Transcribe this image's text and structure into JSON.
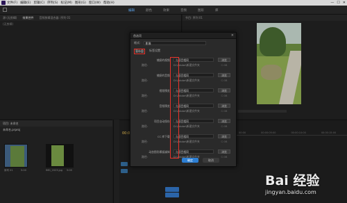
{
  "menubar": {
    "items": [
      "文件(F)",
      "编辑(E)",
      "剪辑(C)",
      "序列(S)",
      "标记(M)",
      "图形(G)",
      "窗口(W)",
      "帮助(H)"
    ],
    "window_buttons": [
      "—",
      "☐",
      "✕"
    ]
  },
  "workspaces": {
    "items": [
      "编辑",
      "颜色",
      "效果",
      "音频",
      "图形",
      "库"
    ],
    "active_index": 0
  },
  "source_panel": {
    "tabs": [
      "源:(无剪辑)",
      "效果控件",
      "音频剪辑混合器: 序列 01"
    ],
    "sub": "(无剪辑)"
  },
  "program_panel": {
    "tab": "节目: 序列 01"
  },
  "project_panel": {
    "tab": "项目: 未命名",
    "title": "未命名.prproj",
    "items": [
      {
        "name": "序列 01",
        "duration": "5:00"
      },
      {
        "name": "IMG_2023.jpg",
        "duration": "5:00"
      }
    ]
  },
  "timeline": {
    "timecode": "00:00:00:00",
    "ruler": [
      "00:00",
      "00:00:05:00",
      "00:00:10:00",
      "00:00:15:00"
    ]
  },
  "dialog": {
    "title": "首选项",
    "format_label": "格式:",
    "format_value": "影像",
    "tabs": [
      "暂存盘",
      "标签设置"
    ],
    "active_tab": 0,
    "settings": [
      {
        "name": "捕捉的视频:",
        "value": "与项目相同",
        "button": "浏览",
        "path_label": "路径:",
        "path": "D:\\Adobe\\新建文件夹",
        "extra": "C:0B"
      },
      {
        "name": "捕捉的音频:",
        "value": "与项目相同",
        "button": "浏览",
        "path_label": "路径:",
        "path": "D:\\Adobe\\新建文件夹",
        "extra": "C:0B"
      },
      {
        "name": "视频预览:",
        "value": "与项目相同",
        "button": "浏览",
        "path_label": "路径:",
        "path": "D:\\Adobe\\新建文件夹",
        "extra": "C:0B"
      },
      {
        "name": "音频预览:",
        "value": "与项目相同",
        "button": "浏览",
        "path_label": "路径:",
        "path": "D:\\Adobe\\新建文件夹",
        "extra": "C:0B"
      },
      {
        "name": "项目自动保存:",
        "value": "与项目相同",
        "button": "浏览",
        "path_label": "路径:",
        "path": "D:\\Adobe\\新建文件夹",
        "extra": "C:0B"
      },
      {
        "name": "CC 库下载:",
        "value": "与项目相同",
        "button": "浏览",
        "path_label": "路径:",
        "path": "D:\\Adobe\\新建文件夹",
        "extra": "C:0B"
      },
      {
        "name": "动态图形模板媒体:",
        "value": "与项目相同",
        "button": "浏览",
        "path_label": "路径:",
        "path": "D:\\Adobe\\新建文件夹",
        "extra": "C:0B"
      }
    ],
    "ok_label": "确定",
    "cancel_label": "取消"
  },
  "watermark": {
    "brand": "Bai 经验",
    "site": "jingyan.baidu.com"
  },
  "colors": {
    "accent": "#2d7fd3",
    "highlight": "#e8322a",
    "timecode": "#d8b04a"
  }
}
